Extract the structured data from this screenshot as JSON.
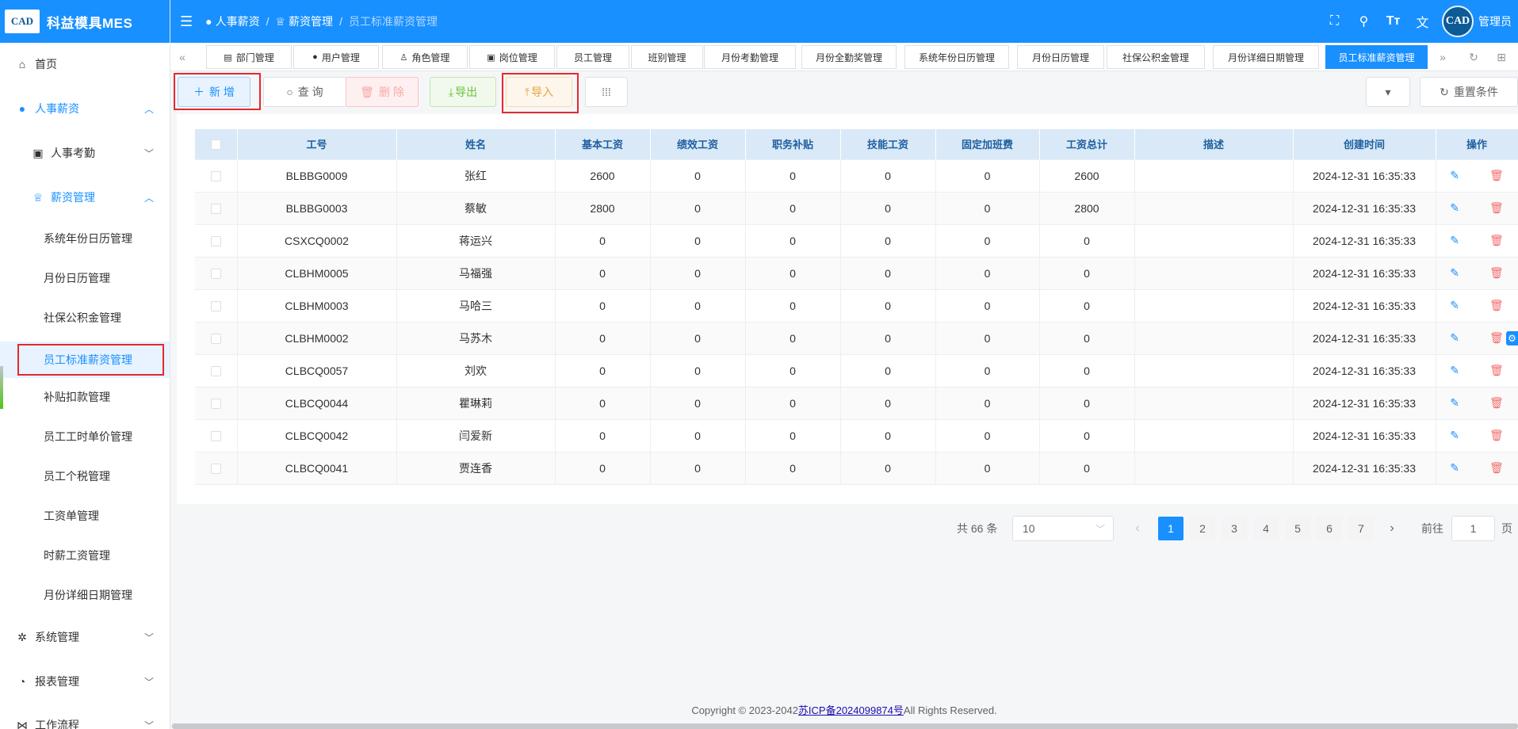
{
  "app": {
    "logo_text": "CAD",
    "title": "科益模具MES"
  },
  "sidebar": {
    "items": [
      {
        "label": "首页",
        "icon": "home-icon"
      },
      {
        "label": "人事薪资",
        "icon": "user-icon"
      },
      {
        "label": "人事考勤",
        "icon": "badge-icon"
      },
      {
        "label": "薪资管理",
        "icon": "trophy-icon"
      },
      {
        "label": "系统年份日历管理"
      },
      {
        "label": "月份日历管理"
      },
      {
        "label": "社保公积金管理"
      },
      {
        "label": "员工标准薪资管理"
      },
      {
        "label": "补贴扣款管理"
      },
      {
        "label": "员工工时单价管理"
      },
      {
        "label": "员工个税管理"
      },
      {
        "label": "工资单管理"
      },
      {
        "label": "时薪工资管理"
      },
      {
        "label": "月份详细日期管理"
      },
      {
        "label": "系统管理",
        "icon": "gear-icon"
      },
      {
        "label": "报表管理",
        "icon": "pie-chart-icon"
      },
      {
        "label": "工作流程",
        "icon": "flow-icon"
      }
    ]
  },
  "header": {
    "breadcrumb": [
      "人事薪资",
      "薪资管理",
      "员工标准薪资管理"
    ],
    "user": "管理员",
    "avatar_text": "CAD"
  },
  "tabs": [
    "部门管理",
    "用户管理",
    "角色管理",
    "岗位管理",
    "员工管理",
    "班别管理",
    "月份考勤管理",
    "月份全勤奖管理",
    "系统年份日历管理",
    "月份日历管理",
    "社保公积金管理",
    "月份详细日期管理",
    "员工标准薪资管理"
  ],
  "toolbar": {
    "add": "新 增",
    "query": "查 询",
    "delete": "删 除",
    "export": "导出",
    "import": "导入",
    "reset": "重置条件"
  },
  "table": {
    "headers": [
      "工号",
      "姓名",
      "基本工资",
      "绩效工资",
      "职务补贴",
      "技能工资",
      "固定加班费",
      "工资总计",
      "描述",
      "创建时间",
      "操作"
    ],
    "rows": [
      [
        "BLBBG0009",
        "张红",
        "2600",
        "0",
        "0",
        "0",
        "0",
        "2600",
        "",
        "2024-12-31 16:35:33"
      ],
      [
        "BLBBG0003",
        "蔡敏",
        "2800",
        "0",
        "0",
        "0",
        "0",
        "2800",
        "",
        "2024-12-31 16:35:33"
      ],
      [
        "CSXCQ0002",
        "蒋运兴",
        "0",
        "0",
        "0",
        "0",
        "0",
        "0",
        "",
        "2024-12-31 16:35:33"
      ],
      [
        "CLBHM0005",
        "马福强",
        "0",
        "0",
        "0",
        "0",
        "0",
        "0",
        "",
        "2024-12-31 16:35:33"
      ],
      [
        "CLBHM0003",
        "马哈三",
        "0",
        "0",
        "0",
        "0",
        "0",
        "0",
        "",
        "2024-12-31 16:35:33"
      ],
      [
        "CLBHM0002",
        "马苏木",
        "0",
        "0",
        "0",
        "0",
        "0",
        "0",
        "",
        "2024-12-31 16:35:33"
      ],
      [
        "CLBCQ0057",
        "刘欢",
        "0",
        "0",
        "0",
        "0",
        "0",
        "0",
        "",
        "2024-12-31 16:35:33"
      ],
      [
        "CLBCQ0044",
        "瞿琳莉",
        "0",
        "0",
        "0",
        "0",
        "0",
        "0",
        "",
        "2024-12-31 16:35:33"
      ],
      [
        "CLBCQ0042",
        "闫爱新",
        "0",
        "0",
        "0",
        "0",
        "0",
        "0",
        "",
        "2024-12-31 16:35:33"
      ],
      [
        "CLBCQ0041",
        "贾连香",
        "0",
        "0",
        "0",
        "0",
        "0",
        "0",
        "",
        "2024-12-31 16:35:33"
      ]
    ]
  },
  "pagination": {
    "total_text": "共 66 条",
    "page_size": "10",
    "pages": [
      "1",
      "2",
      "3",
      "4",
      "5",
      "6",
      "7"
    ],
    "current": "1",
    "goto_label": "前往",
    "goto_value": "1",
    "page_suffix": "页"
  },
  "footer": {
    "prefix": "Copyright © 2023-2042",
    "icp": "苏ICP备2024099874号",
    "suffix": "All Rights Reserved."
  },
  "colors": {
    "primary": "#1890ff",
    "danger": "#f56c6c",
    "success": "#67c23a",
    "warning": "#e6a23c",
    "highlight_box": "#e3292e"
  }
}
